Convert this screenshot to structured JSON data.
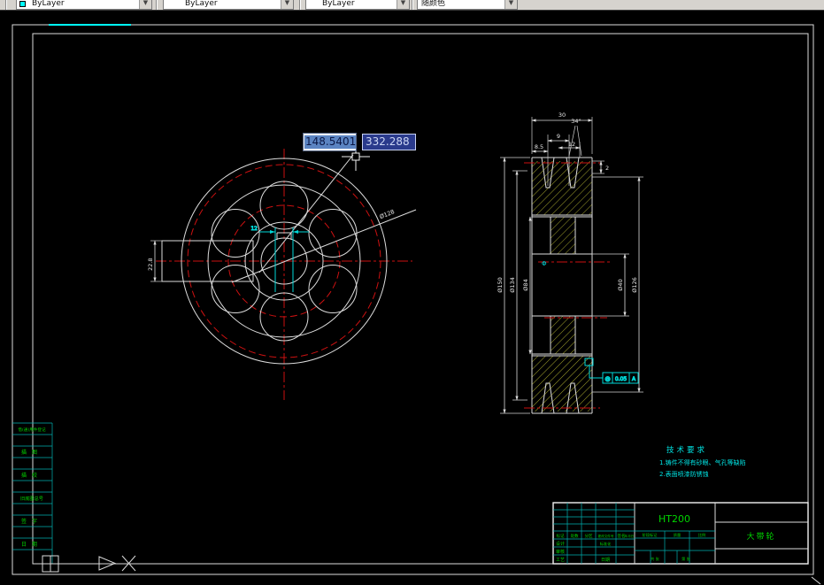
{
  "toolbar": {
    "combos": [
      {
        "label": "ByLayer",
        "swatch": "#00ffff"
      },
      {
        "label": "ByLayer"
      },
      {
        "label": "ByLayer"
      },
      {
        "label": "随颜色"
      }
    ]
  },
  "dynamic_input": {
    "active_value": "148.5401",
    "second_value": "332.288"
  },
  "front_view": {
    "dims": {
      "bolt_circle": "Ø128",
      "keyway_width": "12",
      "keyway_section_height": "22.8"
    }
  },
  "section_view": {
    "dims": {
      "width": "30",
      "groove_angle": "34°",
      "groove_pitch": "12",
      "groove_top_width": "9",
      "edge_offset": "8.5",
      "groove_land": "2",
      "outer_dia": "Ø150",
      "pitch_dia": "Ø134",
      "hub_dia": "Ø84",
      "bore_dia": "Ø40",
      "rim_inner_dia": "Ø126"
    },
    "tolerance": {
      "symbol": "◎",
      "value": "0.05",
      "datum": "A"
    },
    "datum_mark": "Φ"
  },
  "tech_notes": {
    "title": "技术要求",
    "lines": [
      "1.铸件不得有砂眼、气孔等缺陷",
      "2.表面喷漆防锈蚀"
    ]
  },
  "title_block": {
    "material": "HT200",
    "part_name": "大带轮",
    "headers": {
      "mark": "标记",
      "count": "处数",
      "zone": "分区",
      "change_doc": "更改文件号",
      "sign": "签名",
      "date": "年月日"
    },
    "roles": {
      "design": "设计",
      "review": "审核",
      "process": "工艺",
      "standard": "标准化",
      "stamp_date": "日期"
    },
    "fields": {
      "stage": "阶段标记",
      "mass": "质量",
      "scale": "比例",
      "sheets": "共 张",
      "page": "第 张"
    }
  },
  "left_strip": {
    "items": [
      "借(通)用件登记",
      "描图",
      "描校",
      "旧底图总号",
      "签字",
      "日期"
    ]
  },
  "colors": {
    "accent_cyan": "#00ffff",
    "annotation_cyan": "#00d8d8",
    "entity_white": "#dcdcdc",
    "centerline_red": "#cc1111",
    "hatch_yellow": "#b8b832",
    "text_green": "#00d400",
    "dyninput_navy": "#2a3a8c",
    "dyninput_highlight": "#5b84c2"
  }
}
